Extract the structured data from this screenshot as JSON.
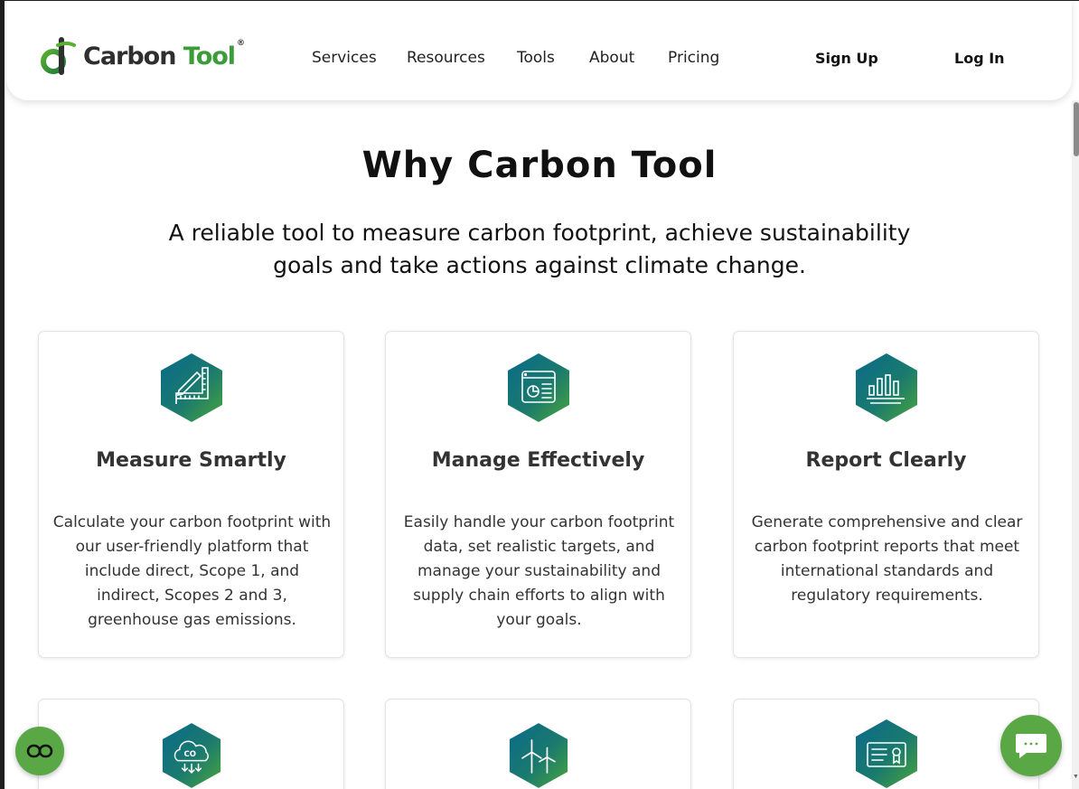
{
  "brand": {
    "name_part1": "Carbon",
    "name_part2": "Tool",
    "registered_mark": "®",
    "colors": {
      "green": "#3a9d3a",
      "teal": "#0e6c8a",
      "dark": "#2f2f2f"
    }
  },
  "nav": {
    "items": [
      {
        "label": "Services"
      },
      {
        "label": "Resources"
      },
      {
        "label": "Tools"
      },
      {
        "label": "About"
      },
      {
        "label": "Pricing"
      }
    ],
    "sign_up": "Sign Up",
    "log_in": "Log In"
  },
  "hero": {
    "title": "Why Carbon Tool",
    "subtitle": "A reliable tool to measure carbon footprint, achieve sustainability goals and take actions against climate change."
  },
  "cards": [
    {
      "icon": "ruler-pencil-icon",
      "title": "Measure Smartly",
      "body": "Calculate your carbon footprint with our user-friendly platform that include direct, Scope 1, and indirect, Scopes 2 and 3, greenhouse gas emissions."
    },
    {
      "icon": "dashboard-chart-icon",
      "title": "Manage Effectively",
      "body": "Easily handle your carbon footprint data, set realistic targets, and manage your sustainability and supply chain efforts to align with your goals."
    },
    {
      "icon": "bar-chart-icon",
      "title": "Report Clearly",
      "body": "Generate comprehensive and clear carbon footprint reports that meet international standards and regulatory requirements."
    },
    {
      "icon": "co2-cloud-icon"
    },
    {
      "icon": "wind-turbine-icon"
    },
    {
      "icon": "certificate-icon"
    }
  ],
  "widgets": {
    "accessibility_icon": "accessibility-icon",
    "chat_icon": "chat-bubble-icon",
    "button_color": "#5aa845"
  }
}
